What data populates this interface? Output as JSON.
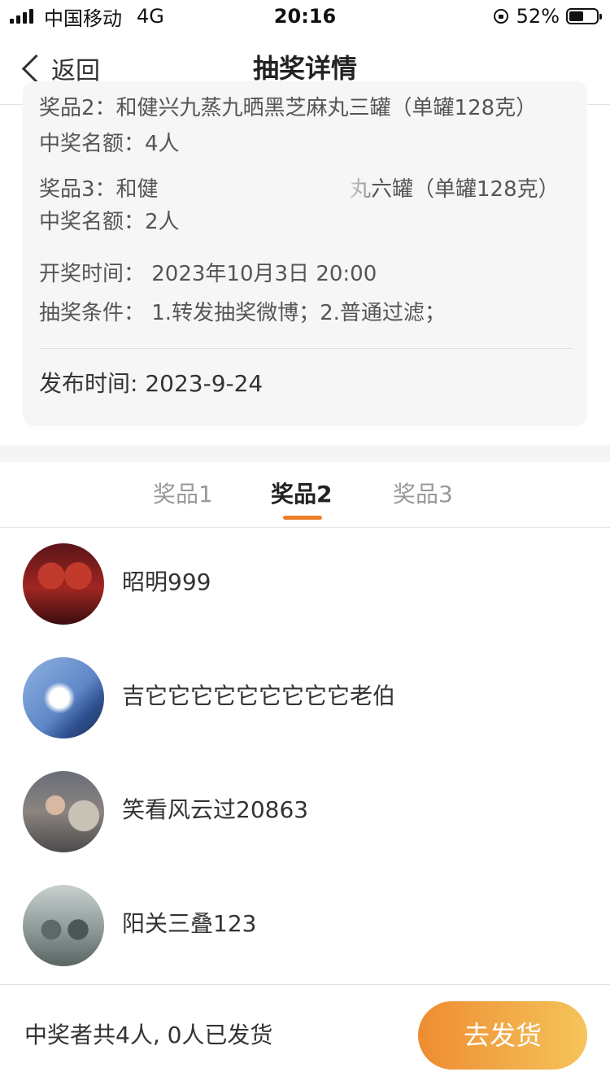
{
  "status_bar": {
    "carrier": "中国移动",
    "network": "4G",
    "time": "20:16",
    "battery": "52%",
    "battery_level": 0.52
  },
  "nav": {
    "back_label": "返回",
    "title": "抽奖详情"
  },
  "info": {
    "prize2_text": "奖品2：和健兴九蒸九晒黑芝麻丸三罐（单罐128克）",
    "prize2_count": "中奖名额：4人",
    "prize3_text_left": "奖品3：和健",
    "prize3_text_right": "丸六罐（单罐128克）",
    "prize3_count": "中奖名额：2人",
    "draw_time": "开奖时间： 2023年10月3日 20:00",
    "conditions": "抽奖条件： 1.转发抽奖微博；2.普通过滤；",
    "publish_time": "发布时间: 2023-9-24"
  },
  "tabs": [
    {
      "label": "奖品1",
      "active": false
    },
    {
      "label": "奖品2",
      "active": true
    },
    {
      "label": "奖品3",
      "active": false
    }
  ],
  "winners": [
    {
      "name": "昭明999"
    },
    {
      "name": "吉它它它它它它它它它老伯"
    },
    {
      "name": "笑看风云过20863"
    },
    {
      "name": "阳关三叠123"
    }
  ],
  "footer": {
    "summary": "中奖者共4人, 0人已发货",
    "ship_button": "去发货"
  },
  "colors": {
    "accent": "#ee7f2a",
    "button_gradient_start": "#ee8c32",
    "button_gradient_end": "#f4c45a"
  }
}
